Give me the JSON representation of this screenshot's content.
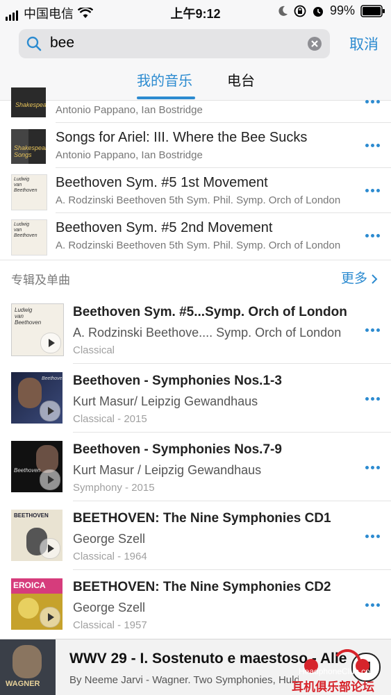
{
  "status_bar": {
    "carrier": "中国电信",
    "time": "上午9:12",
    "battery": "99%"
  },
  "search": {
    "query": "bee",
    "cancel_label": "取消"
  },
  "tabs": [
    {
      "label": "我的音乐",
      "active": true
    },
    {
      "label": "电台",
      "active": false
    }
  ],
  "songs": [
    {
      "title": "",
      "subtitle": "Antonio Pappano, Ian Bostridge"
    },
    {
      "title": "Songs for Ariel: III. Where the Bee Sucks",
      "subtitle": "Antonio Pappano, Ian Bostridge"
    },
    {
      "title": "Beethoven Sym. #5 1st Movement",
      "subtitle": "A. Rodzinski Beethoven 5th Sym. Phil. Symp. Orch of London"
    },
    {
      "title": "Beethoven Sym. #5 2nd Movement",
      "subtitle": "A. Rodzinski Beethoven 5th Sym. Phil. Symp. Orch of London"
    }
  ],
  "albums_section": {
    "label": "专辑及单曲",
    "more_label": "更多"
  },
  "albums": [
    {
      "title": "Beethoven Sym. #5...Symp. Orch of London",
      "artist": "A. Rodzinski Beethove.... Symp. Orch of London",
      "meta": "Classical"
    },
    {
      "title": "Beethoven - Symphonies Nos.1-3",
      "artist": "Kurt Masur/ Leipzig Gewandhaus",
      "meta": "Classical - 2015"
    },
    {
      "title": "Beethoven - Symphonies Nos.7-9",
      "artist": "Kurt Masur / Leipzig Gewandhaus",
      "meta": "Symphony - 2015"
    },
    {
      "title": "BEETHOVEN: The Nine Symphonies CD1",
      "artist": "George Szell",
      "meta": "Classical - 1964"
    },
    {
      "title": "BEETHOVEN: The Nine Symphonies CD2",
      "artist": "George Szell",
      "meta": "Classical - 1957"
    }
  ],
  "now_playing": {
    "title": "WWV 29 - I. Sostenuto e maestoso - Alleg",
    "subtitle": "By Neeme Jarvi - Wagner. Two Symphonies, Huldigungs"
  },
  "watermark": {
    "line1": "HeadphoneClub.com",
    "line2": "耳机俱乐部论坛"
  },
  "colors": {
    "accent": "#2c8bd0",
    "watermark": "#d6242b"
  }
}
